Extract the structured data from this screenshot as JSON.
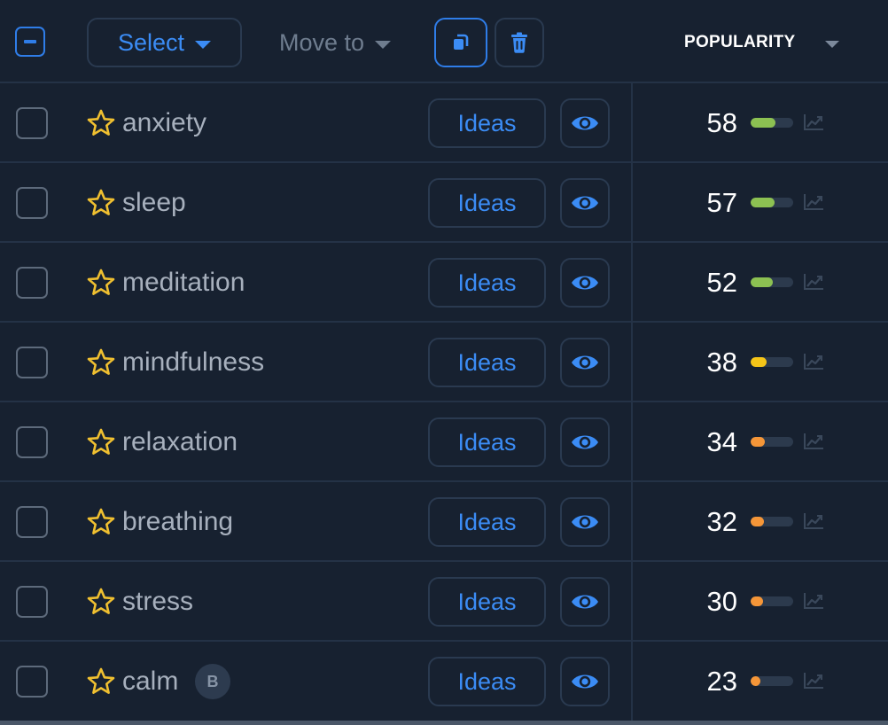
{
  "toolbar": {
    "select_label": "Select",
    "move_to_label": "Move to",
    "column_header": "POPULARITY"
  },
  "colors": {
    "accent": "#3b8cf5",
    "star": "#f0c030",
    "level_high": "#8cc152",
    "level_mid": "#f5c518",
    "level_low": "#f59638"
  },
  "rows": [
    {
      "keyword": "anxiety",
      "ideas_label": "Ideas",
      "popularity": 58,
      "level": "high"
    },
    {
      "keyword": "sleep",
      "ideas_label": "Ideas",
      "popularity": 57,
      "level": "high"
    },
    {
      "keyword": "meditation",
      "ideas_label": "Ideas",
      "popularity": 52,
      "level": "high"
    },
    {
      "keyword": "mindfulness",
      "ideas_label": "Ideas",
      "popularity": 38,
      "level": "mid"
    },
    {
      "keyword": "relaxation",
      "ideas_label": "Ideas",
      "popularity": 34,
      "level": "low"
    },
    {
      "keyword": "breathing",
      "ideas_label": "Ideas",
      "popularity": 32,
      "level": "low"
    },
    {
      "keyword": "stress",
      "ideas_label": "Ideas",
      "popularity": 30,
      "level": "low"
    },
    {
      "keyword": "calm",
      "ideas_label": "Ideas",
      "popularity": 23,
      "level": "low",
      "badge": "B"
    }
  ]
}
